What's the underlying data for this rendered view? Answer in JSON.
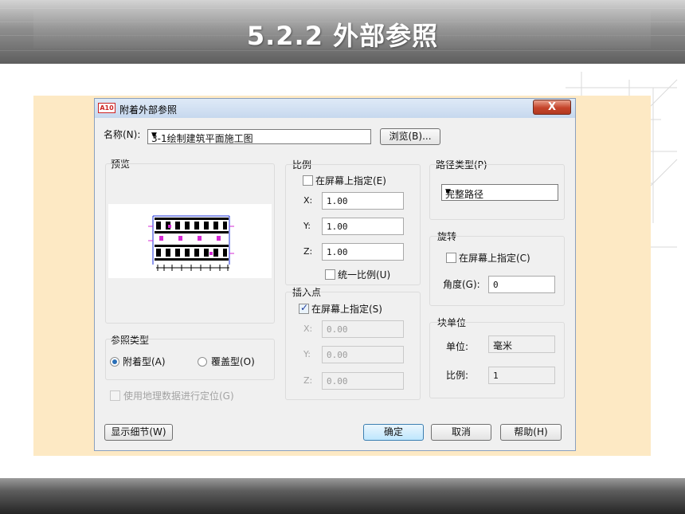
{
  "slide": {
    "title": "5.2.2  外部参照"
  },
  "dialog": {
    "title": "附着外部参照",
    "app_icon": "A10",
    "close_label": "X",
    "name_label": "名称(N):",
    "name_value": "3-1绘制建筑平面施工图",
    "browse_label": "浏览(B)...",
    "preview_label": "预览",
    "ref_type": {
      "label": "参照类型",
      "attach": "附着型(A)",
      "overlay": "覆盖型(O)",
      "selected": "attach"
    },
    "geo_label": "使用地理数据进行定位(G)",
    "scale": {
      "label": "比例",
      "onscreen": "在屏幕上指定(E)",
      "onscreen_checked": false,
      "x_label": "X:",
      "x": "1.00",
      "y_label": "Y:",
      "y": "1.00",
      "z_label": "Z:",
      "z": "1.00",
      "uniform": "统一比例(U)",
      "uniform_checked": false
    },
    "insert": {
      "label": "插入点",
      "onscreen": "在屏幕上指定(S)",
      "onscreen_checked": true,
      "x_label": "X:",
      "x": "0.00",
      "y_label": "Y:",
      "y": "0.00",
      "z_label": "Z:",
      "z": "0.00"
    },
    "path": {
      "label": "路径类型(P)",
      "value": "完整路径"
    },
    "rotation": {
      "label": "旋转",
      "onscreen": "在屏幕上指定(C)",
      "onscreen_checked": false,
      "angle_label": "角度(G):",
      "angle": "0"
    },
    "block_unit": {
      "label": "块单位",
      "unit_label": "单位:",
      "unit": "毫米",
      "factor_label": "比例:",
      "factor": "1"
    },
    "buttons": {
      "details": "显示细节(W)",
      "ok": "确定",
      "cancel": "取消",
      "help": "帮助(H)"
    }
  },
  "colors": {
    "backdrop": "#fde9c4",
    "dialog_bg": "#f0f0f0",
    "close_button": "#c5442a"
  }
}
